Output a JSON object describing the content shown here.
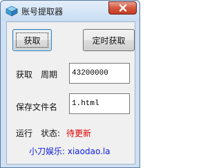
{
  "window": {
    "title": "账号提取器",
    "icon": "app-icon",
    "close_icon": "close-icon",
    "accent": "#c53a22"
  },
  "buttons": {
    "get": "获取",
    "timed_get": "定时获取"
  },
  "form": {
    "period_label_1": "获取",
    "period_label_2": "周期",
    "period_value": "43200000",
    "file_label": "保存文件名",
    "file_value": "1.html"
  },
  "status": {
    "run_label": "运行",
    "state_label": "状态:",
    "state_value": "待更新",
    "state_color": "#e00000"
  },
  "footer": {
    "link_text": "小刀娱乐: xiaodao.la",
    "link_color": "#1020e0"
  }
}
